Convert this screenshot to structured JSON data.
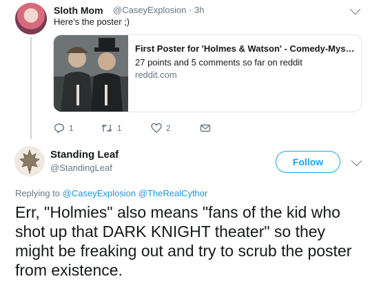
{
  "tweet1": {
    "name": "Sloth Mom",
    "handle_time": "@CaseyExplosion · 3h",
    "text": "Here's the poster ;)",
    "card": {
      "title": "First Poster for 'Holmes & Watson' - Comedy-Myst...",
      "description": "27 points and 5 comments so far on reddit",
      "domain": "reddit.com"
    },
    "actions": {
      "reply_count": "1",
      "retweet_count": "1",
      "like_count": "2"
    }
  },
  "tweet2": {
    "name": "Standing Leaf",
    "handle": "@StandingLeaf",
    "follow_label": "Follow",
    "replying_prefix": "Replying to",
    "replying_to_1": "@CaseyExplosion",
    "replying_to_2": "@TheRealCythor",
    "text": "Err, \"Holmies\" also means \"fans of the kid who shot up that DARK KNIGHT theater\" so they might be freaking out and try to scrub the poster from existence."
  }
}
